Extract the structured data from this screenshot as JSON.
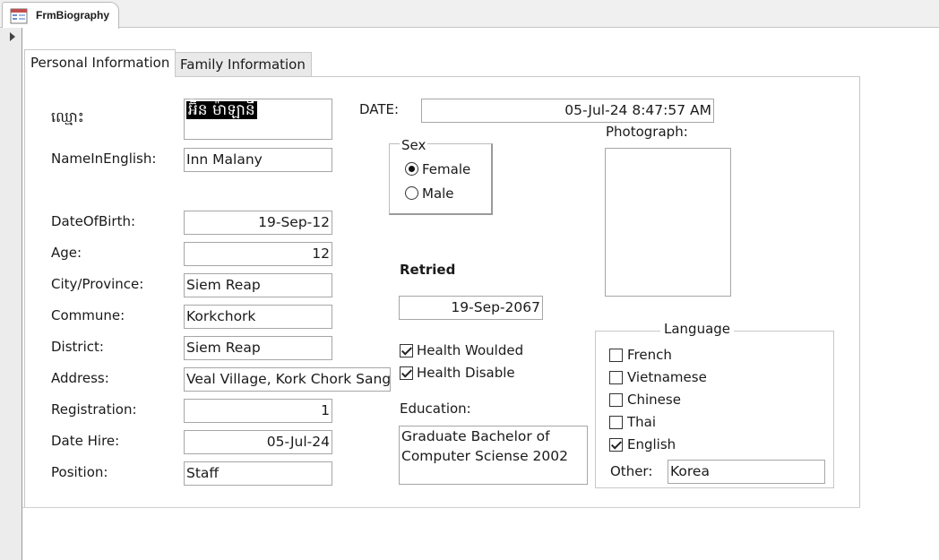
{
  "document": {
    "tab_title": "FrmBiography"
  },
  "tabs": [
    "Personal Information",
    "Family Information"
  ],
  "fields": {
    "khmer_name_label": "ឈ្មោះ",
    "khmer_name_value": "អ៊ិន ម៉ាឡានី",
    "name_english_label": "NameInEnglish:",
    "name_english_value": "Inn Malany",
    "dob_label": "DateOfBirth:",
    "dob_value": "19-Sep-12",
    "age_label": "Age:",
    "age_value": "12",
    "city_label": "City/Province:",
    "city_value": "Siem Reap",
    "commune_label": "Commune:",
    "commune_value": "Korkchork",
    "district_label": "District:",
    "district_value": "Siem Reap",
    "address_label": "Address:",
    "address_value": "Veal Village, Kork Chork Sangkat",
    "registration_label": "Registration:",
    "registration_value": "1",
    "date_hire_label": "Date Hire:",
    "date_hire_value": "05-Jul-24",
    "position_label": "Position:",
    "position_value": "Staff",
    "date_label": "DATE:",
    "date_value": "05-Jul-24 8:47:57 AM",
    "retried_label": "Retried",
    "retried_value": "19-Sep-2067",
    "photograph_label": "Photograph:"
  },
  "sex": {
    "label": "Sex",
    "options": [
      {
        "label": "Female",
        "checked": true
      },
      {
        "label": "Male",
        "checked": false
      }
    ]
  },
  "health": [
    {
      "label": "Health Woulded",
      "checked": true
    },
    {
      "label": "Health Disable",
      "checked": true
    }
  ],
  "education": {
    "label": "Education:",
    "value": "Graduate Bachelor of\nComputer Sciense 2002"
  },
  "language": {
    "label": "Language",
    "options": [
      {
        "label": "French",
        "checked": false
      },
      {
        "label": "Vietnamese",
        "checked": false
      },
      {
        "label": "Chinese",
        "checked": false
      },
      {
        "label": "Thai",
        "checked": false
      },
      {
        "label": "English",
        "checked": true
      }
    ],
    "other_label": "Other:",
    "other_value": "Korea"
  }
}
